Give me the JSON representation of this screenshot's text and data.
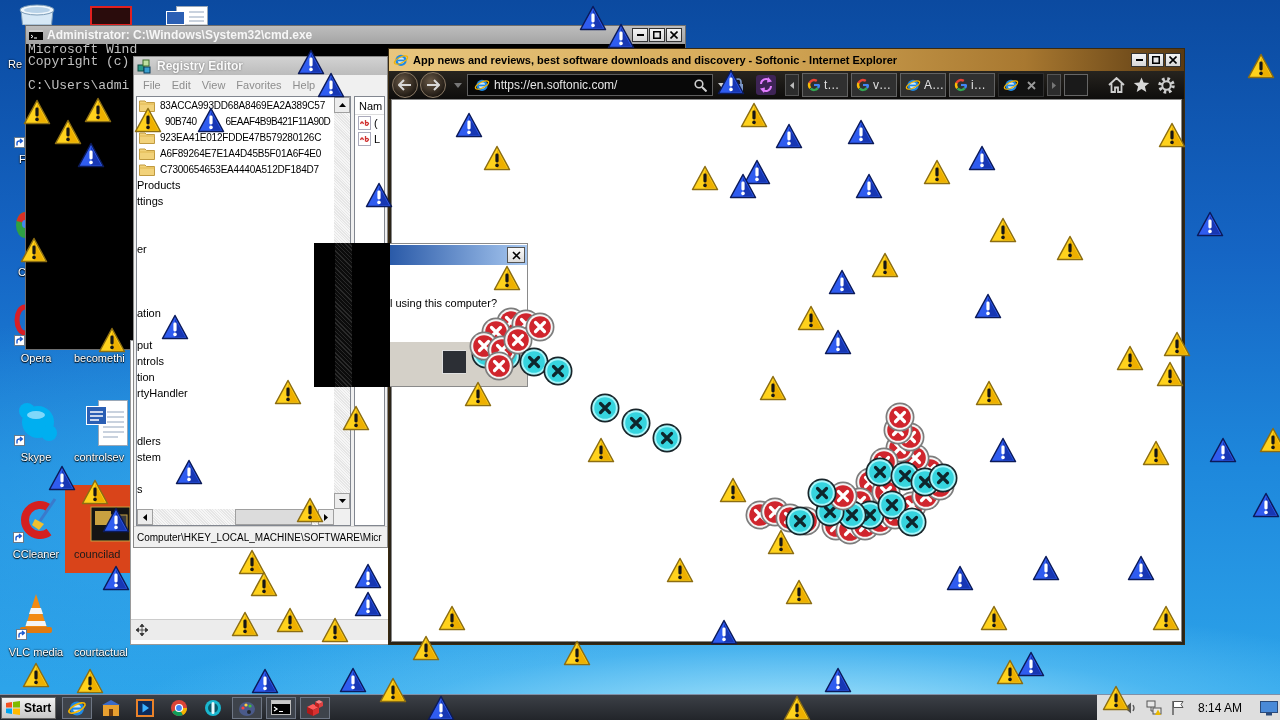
{
  "desktop_icons": [
    {
      "kind": "recycle_bin",
      "label": "Re"
    },
    {
      "kind": "shortcut",
      "label": "F"
    },
    {
      "kind": "round_app",
      "label": "C"
    },
    {
      "kind": "opera",
      "label": "Opera"
    },
    {
      "kind": "hidden",
      "label": "becomethi"
    },
    {
      "kind": "skype",
      "label": "Skype"
    },
    {
      "kind": "word_document",
      "label": "controlsev"
    },
    {
      "kind": "ccleaner",
      "label": "CCleaner"
    },
    {
      "kind": "thumbnail",
      "label": "councilad"
    },
    {
      "kind": "vlc",
      "label": "VLC media"
    },
    {
      "kind": "hidden",
      "label": "courtactual"
    }
  ],
  "cmd_window": {
    "title": "Administrator: C:\\Windows\\System32\\cmd.exe",
    "lines": [
      "Microsoft Wind",
      "Copyright (c)",
      "C:\\Users\\admi"
    ]
  },
  "registry_editor": {
    "title": "Registry Editor",
    "menu": [
      "File",
      "Edit",
      "View",
      "Favorites",
      "Help"
    ],
    "tree": [
      {
        "kind": "key",
        "fragments": [
          "83ACCA993DD68A8469EA2A389C57"
        ]
      },
      {
        "kind": "covered_key",
        "fragments": [
          "90B740",
          "6EAAF4B9B421F11A90D"
        ]
      },
      {
        "kind": "key",
        "fragments": [
          "923EA41E012FDDE47B579280126C"
        ]
      },
      {
        "kind": "key",
        "fragments": [
          "A6F89264E7E1A4D45B5F01A6F4E0"
        ]
      },
      {
        "kind": "key",
        "fragments": [
          "C7300654653EA4440A512DF184D7"
        ]
      },
      {
        "kind": "clipped",
        "fragments": [
          "Products"
        ]
      },
      {
        "kind": "clipped",
        "fragments": [
          "ttings"
        ]
      },
      {
        "kind": "clipped",
        "fragments": [
          "er"
        ]
      },
      {
        "kind": "clipped",
        "fragments": [
          "ation"
        ]
      },
      {
        "kind": "clipped",
        "fragments": [
          "put"
        ]
      },
      {
        "kind": "clipped",
        "fragments": [
          "ntrols"
        ]
      },
      {
        "kind": "clipped",
        "fragments": [
          "tion"
        ]
      },
      {
        "kind": "clipped",
        "fragments": [
          "rtyHandler"
        ]
      },
      {
        "kind": "clipped",
        "fragments": [
          "dlers"
        ]
      },
      {
        "kind": "clipped",
        "fragments": [
          "stem"
        ]
      },
      {
        "kind": "clipped",
        "fragments": [
          "s"
        ]
      }
    ],
    "list_header": "Nam",
    "values": [
      "(",
      "L"
    ],
    "status": "Computer\\HKEY_LOCAL_MACHINE\\SOFTWARE\\Micr"
  },
  "browser": {
    "title": "App news and reviews, best software downloads and discovery - Softonic - Internet Explorer",
    "address": "https://en.softonic.com/",
    "tabs": [
      {
        "kind": "google",
        "label": "t…",
        "selected": false
      },
      {
        "kind": "google",
        "label": "v…",
        "selected": false
      },
      {
        "kind": "ie",
        "label": "A…",
        "selected": false
      },
      {
        "kind": "google",
        "label": "i…",
        "selected": false
      },
      {
        "kind": "ie",
        "selected": true
      }
    ],
    "dialog": {
      "message": "l using this computer?"
    }
  },
  "taskbar": {
    "start": "Start",
    "items": [
      {
        "kind": "ie",
        "running": true
      },
      {
        "kind": "explorer",
        "running": false
      },
      {
        "kind": "media_player",
        "running": false
      },
      {
        "kind": "chrome",
        "running": false
      },
      {
        "kind": "ring",
        "running": false
      },
      {
        "kind": "paint",
        "running": true
      },
      {
        "kind": "cmd",
        "running": true
      },
      {
        "kind": "regedit",
        "running": true
      }
    ],
    "clock": "8:14 AM"
  }
}
